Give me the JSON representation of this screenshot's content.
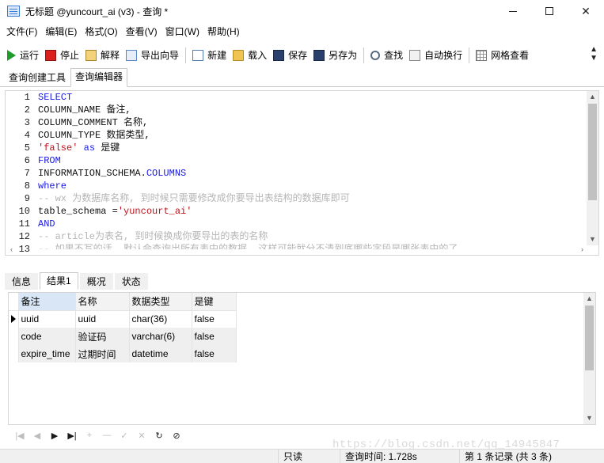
{
  "window": {
    "title": "无标题 @yuncourt_ai (v3) - 查询 *",
    "icon": "navicat-window-icon"
  },
  "menu": [
    "文件(F)",
    "编辑(E)",
    "格式(O)",
    "查看(V)",
    "窗口(W)",
    "帮助(H)"
  ],
  "toolbar": {
    "run": "运行",
    "stop": "停止",
    "explain": "解释",
    "export_wizard": "导出向导",
    "new": "新建",
    "load": "载入",
    "save": "保存",
    "save_as": "另存为",
    "find": "查找",
    "auto_wrap": "自动换行",
    "grid_view": "网格查看",
    "more": "»"
  },
  "tabs_top": {
    "builder": "查询创建工具",
    "editor": "查询编辑器"
  },
  "editor": {
    "line_numbers": [
      "1",
      "2",
      "3",
      "4",
      "5",
      "6",
      "7",
      "8",
      "9",
      "10",
      "11",
      "12",
      "13"
    ],
    "lines": [
      [
        {
          "t": "SELECT",
          "c": "kw"
        }
      ],
      [
        {
          "t": "COLUMN_NAME 备注,",
          "c": "plain"
        }
      ],
      [
        {
          "t": "COLUMN_COMMENT 名称,",
          "c": "plain"
        }
      ],
      [
        {
          "t": "COLUMN_TYPE 数据类型,",
          "c": "plain"
        }
      ],
      [
        {
          "t": "'false'",
          "c": "str"
        },
        {
          "t": " as ",
          "c": "kw"
        },
        {
          "t": "是键",
          "c": "plain"
        }
      ],
      [
        {
          "t": "FROM",
          "c": "kw"
        }
      ],
      [
        {
          "t": "INFORMATION_SCHEMA.",
          "c": "plain"
        },
        {
          "t": "COLUMNS",
          "c": "kw"
        }
      ],
      [
        {
          "t": "where",
          "c": "kw"
        }
      ],
      [
        {
          "t": "-- wx 为数据库名称, 到时候只需要修改成你要导出表结构的数据库即可",
          "c": "cmt"
        }
      ],
      [
        {
          "t": "table_schema =",
          "c": "plain"
        },
        {
          "t": "'yuncourt_ai'",
          "c": "str"
        }
      ],
      [
        {
          "t": "AND",
          "c": "kw"
        }
      ],
      [
        {
          "t": "-- article为表名, 到时候换成你要导出的表的名称",
          "c": "cmt"
        }
      ],
      [
        {
          "t": "-- 如果不写的话, 默认会查询出所有表中的数据, 这样可能就分不清到底哪些字段是哪张表中的了",
          "c": "cmt"
        }
      ]
    ]
  },
  "result_tabs": [
    "信息",
    "结果1",
    "概况",
    "状态"
  ],
  "result_grid": {
    "columns": [
      "备注",
      "名称",
      "数据类型",
      "是键"
    ],
    "rows": [
      [
        "uuid",
        "uuid",
        "char(36)",
        "false"
      ],
      [
        "code",
        "验证码",
        "varchar(6)",
        "false"
      ],
      [
        "expire_time",
        "过期时间",
        "datetime",
        "false"
      ]
    ]
  },
  "nav": [
    "|◀",
    "◀",
    "▶",
    "▶|",
    "+",
    "—",
    "✓",
    "✕",
    "↻",
    "⊘"
  ],
  "status": {
    "readonly": "只读",
    "query_time": "查询时间: 1.728s",
    "record": "第 1 条记录 (共 3 条)"
  },
  "watermark": "https://blog.csdn.net/qq_14945847"
}
